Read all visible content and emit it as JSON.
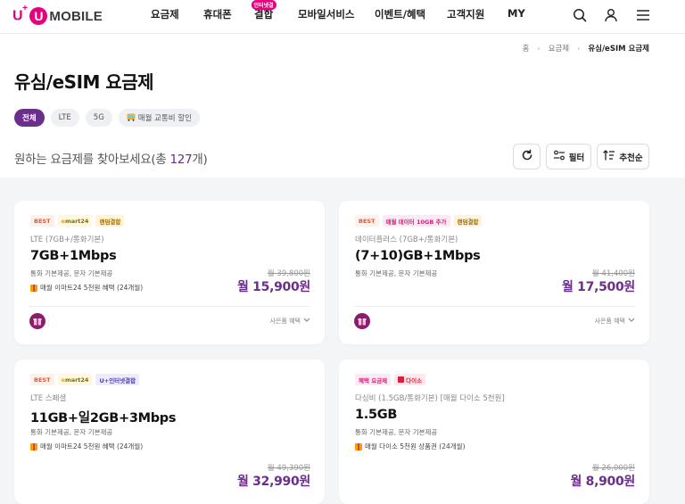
{
  "header": {
    "logo": {
      "uplus": "U",
      "uplus_sup": "+",
      "u_mark": "U",
      "mobile": "MOBILE"
    },
    "nav": [
      {
        "label": "요금제"
      },
      {
        "label": "휴대폰"
      },
      {
        "label": "결합",
        "badge": "인터넷결"
      },
      {
        "label": "모바일서비스"
      },
      {
        "label": "이벤트/혜택"
      },
      {
        "label": "고객지원"
      },
      {
        "label": "MY"
      }
    ],
    "icons": [
      "search-icon",
      "user-icon",
      "menu-icon"
    ]
  },
  "breadcrumb": {
    "home": "홈",
    "level1": "요금제",
    "current": "유심/eSIM 요금제",
    "sep": "›"
  },
  "page_title": "유심/eSIM 요금제",
  "filter_chips": [
    {
      "label": "전체",
      "active": true
    },
    {
      "label": "LTE",
      "active": false
    },
    {
      "label": "5G",
      "active": false
    },
    {
      "label": "매월 교통비 할인",
      "active": false,
      "icon": "bus-icon"
    }
  ],
  "results": {
    "prefix": "원하는 요금제를 찾아보세요(총 ",
    "count": "127",
    "suffix": "개)"
  },
  "toolbar": {
    "refresh_icon": "refresh-icon",
    "filter_label": "필터",
    "sort_label": "추천순"
  },
  "cards": [
    {
      "tags": [
        {
          "type": "best",
          "label": "BEST"
        },
        {
          "type": "emart",
          "label_a": "e",
          "label_b": "mart24"
        },
        {
          "type": "random",
          "label": "랜덤결합"
        }
      ],
      "sub": "LTE (7GB+/통화기본)",
      "name": "7GB+1Mbps",
      "desc": "통화 기본제공, 문자 기본제공",
      "gift": "매월 이마트24 5천원 혜택 (24개월)",
      "orig_price": "월 39,800원",
      "price": "월 15,900원",
      "gift_more": "사은품 혜택"
    },
    {
      "tags": [
        {
          "type": "best",
          "label": "BEST"
        },
        {
          "type": "data",
          "label": "매월 데이터 10GB 추가"
        },
        {
          "type": "random",
          "label": "랜덤결합"
        }
      ],
      "sub": "데이터플러스 (7GB+/통화기본)",
      "name": "(7+10)GB+1Mbps",
      "desc": "통화 기본제공, 문자 기본제공",
      "orig_price": "월 41,400원",
      "price": "월 17,500원",
      "gift_more": "사은품 혜택"
    },
    {
      "tags": [
        {
          "type": "best",
          "label": "BEST"
        },
        {
          "type": "emart",
          "label_a": "e",
          "label_b": "mart24"
        },
        {
          "type": "internet",
          "label": "U+인터넷결합"
        }
      ],
      "sub": "LTE 스페셜",
      "name": "11GB+일2GB+3Mbps",
      "desc": "통화 기본제공, 문자 기본제공",
      "gift": "매월 이마트24 5천원 혜택 (24개월)",
      "orig_price": "월 49,390원",
      "price": "월 32,990원"
    },
    {
      "tags": [
        {
          "type": "benefit",
          "label": "혜택 요금제"
        },
        {
          "type": "daiso",
          "label": "다이소"
        }
      ],
      "sub": "다싱비 (1.5GB/통화기본) [매월 다이소 5천원]",
      "name": "1.5GB",
      "desc": "통화 기본제공, 문자 기본제공",
      "gift": "매월 다이소 5천원 상품권 (24개월)",
      "orig_price": "월 26,000원",
      "price": "월 8,900원"
    }
  ],
  "colors": {
    "brand_pink": "#e6007e",
    "brand_purple": "#6b2e8a",
    "best_orange": "#e8543a"
  }
}
